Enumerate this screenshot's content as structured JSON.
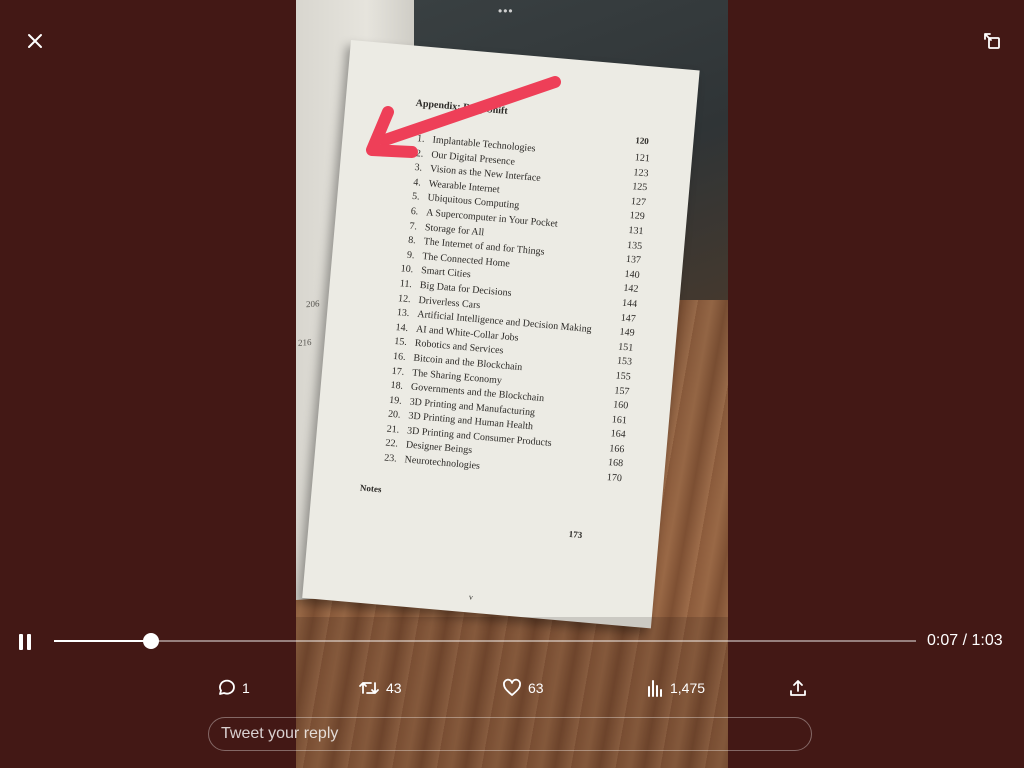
{
  "player": {
    "time_readout": "0:07 / 1:03",
    "progress_fraction": 0.113
  },
  "actions": {
    "replies": "1",
    "reposts": "43",
    "likes": "63",
    "views": "1,475"
  },
  "reply": {
    "placeholder": "Tweet your reply"
  },
  "colors": {
    "backdrop": "#431815",
    "annotation_arrow": "#ee3f58"
  },
  "icons": [
    "close-icon",
    "expand-icon",
    "pause-icon",
    "reply-icon",
    "repost-icon",
    "like-icon",
    "views-icon",
    "share-icon"
  ],
  "book": {
    "heading": "Appendix: Deep Shift",
    "heading_page": "120",
    "left_page_numbers": [
      "206",
      "216"
    ],
    "toc": [
      {
        "num": "1.",
        "title": "Implantable Technologies",
        "page": "121"
      },
      {
        "num": "2.",
        "title": "Our Digital Presence",
        "page": "123"
      },
      {
        "num": "3.",
        "title": "Vision as the New Interface",
        "page": "125"
      },
      {
        "num": "4.",
        "title": "Wearable Internet",
        "page": "127"
      },
      {
        "num": "5.",
        "title": "Ubiquitous Computing",
        "page": "129"
      },
      {
        "num": "6.",
        "title": "A Supercomputer in Your Pocket",
        "page": "131"
      },
      {
        "num": "7.",
        "title": "Storage for All",
        "page": "135"
      },
      {
        "num": "8.",
        "title": "The Internet of and for Things",
        "page": "137"
      },
      {
        "num": "9.",
        "title": "The Connected Home",
        "page": "140"
      },
      {
        "num": "10.",
        "title": "Smart Cities",
        "page": "142"
      },
      {
        "num": "11.",
        "title": "Big Data for Decisions",
        "page": "144"
      },
      {
        "num": "12.",
        "title": "Driverless Cars",
        "page": "147"
      },
      {
        "num": "13.",
        "title": "Artificial Intelligence and Decision Making",
        "page": "149"
      },
      {
        "num": "14.",
        "title": "AI and White-Collar Jobs",
        "page": "151"
      },
      {
        "num": "15.",
        "title": "Robotics and Services",
        "page": "153"
      },
      {
        "num": "16.",
        "title": "Bitcoin and the Blockchain",
        "page": "155"
      },
      {
        "num": "17.",
        "title": "The Sharing Economy",
        "page": "157"
      },
      {
        "num": "18.",
        "title": "Governments and the Blockchain",
        "page": "160"
      },
      {
        "num": "19.",
        "title": "3D Printing and Manufacturing",
        "page": "161"
      },
      {
        "num": "20.",
        "title": "3D Printing and Human Health",
        "page": "164"
      },
      {
        "num": "21.",
        "title": "3D Printing and Consumer Products",
        "page": "166"
      },
      {
        "num": "22.",
        "title": "Designer Beings",
        "page": "168"
      },
      {
        "num": "23.",
        "title": "Neurotechnologies",
        "page": "170"
      }
    ],
    "notes_label": "Notes",
    "notes_page": "173",
    "roman_page": "v"
  }
}
